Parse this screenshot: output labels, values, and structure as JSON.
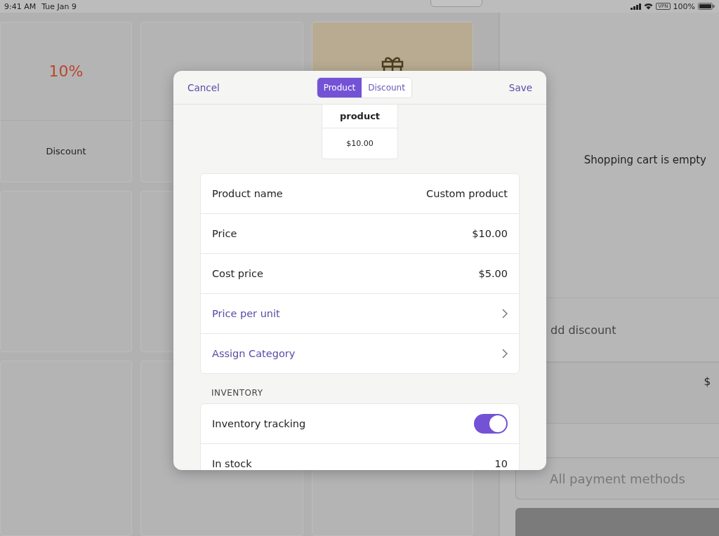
{
  "status_bar": {
    "time": "9:41 AM",
    "date": "Tue Jan 9",
    "vpn": "VPN",
    "battery": "100%"
  },
  "tiles": [
    {
      "kind": "percent",
      "label": "10%",
      "caption": "Discount"
    },
    {
      "kind": "percent"
    },
    {
      "kind": "gift"
    },
    {
      "kind": "empty"
    },
    {
      "kind": "empty"
    },
    {
      "kind": "covered"
    },
    {
      "kind": "empty"
    },
    {
      "kind": "empty"
    },
    {
      "kind": "empty"
    }
  ],
  "cart": {
    "empty_message": "Shopping cart is empty",
    "discount_label": "dd discount",
    "currency": "$",
    "payment_button": "All payment methods"
  },
  "modal": {
    "cancel": "Cancel",
    "save": "Save",
    "segments": [
      {
        "label": "Product",
        "selected": true
      },
      {
        "label": "Discount",
        "selected": false
      }
    ],
    "preview": {
      "name": "product",
      "price": "$10.00"
    },
    "fields": [
      {
        "kind": "value",
        "label": "Product name",
        "value": "Custom product"
      },
      {
        "kind": "value",
        "label": "Price",
        "value": "$10.00"
      },
      {
        "kind": "value",
        "label": "Cost price",
        "value": "$5.00"
      },
      {
        "kind": "link",
        "label": "Price per unit"
      },
      {
        "kind": "link",
        "label": "Assign Category"
      }
    ],
    "section_title": "INVENTORY",
    "inventory": [
      {
        "kind": "toggle",
        "label": "Inventory tracking",
        "on": true
      },
      {
        "kind": "value",
        "label": "In stock",
        "value": "10"
      }
    ]
  }
}
